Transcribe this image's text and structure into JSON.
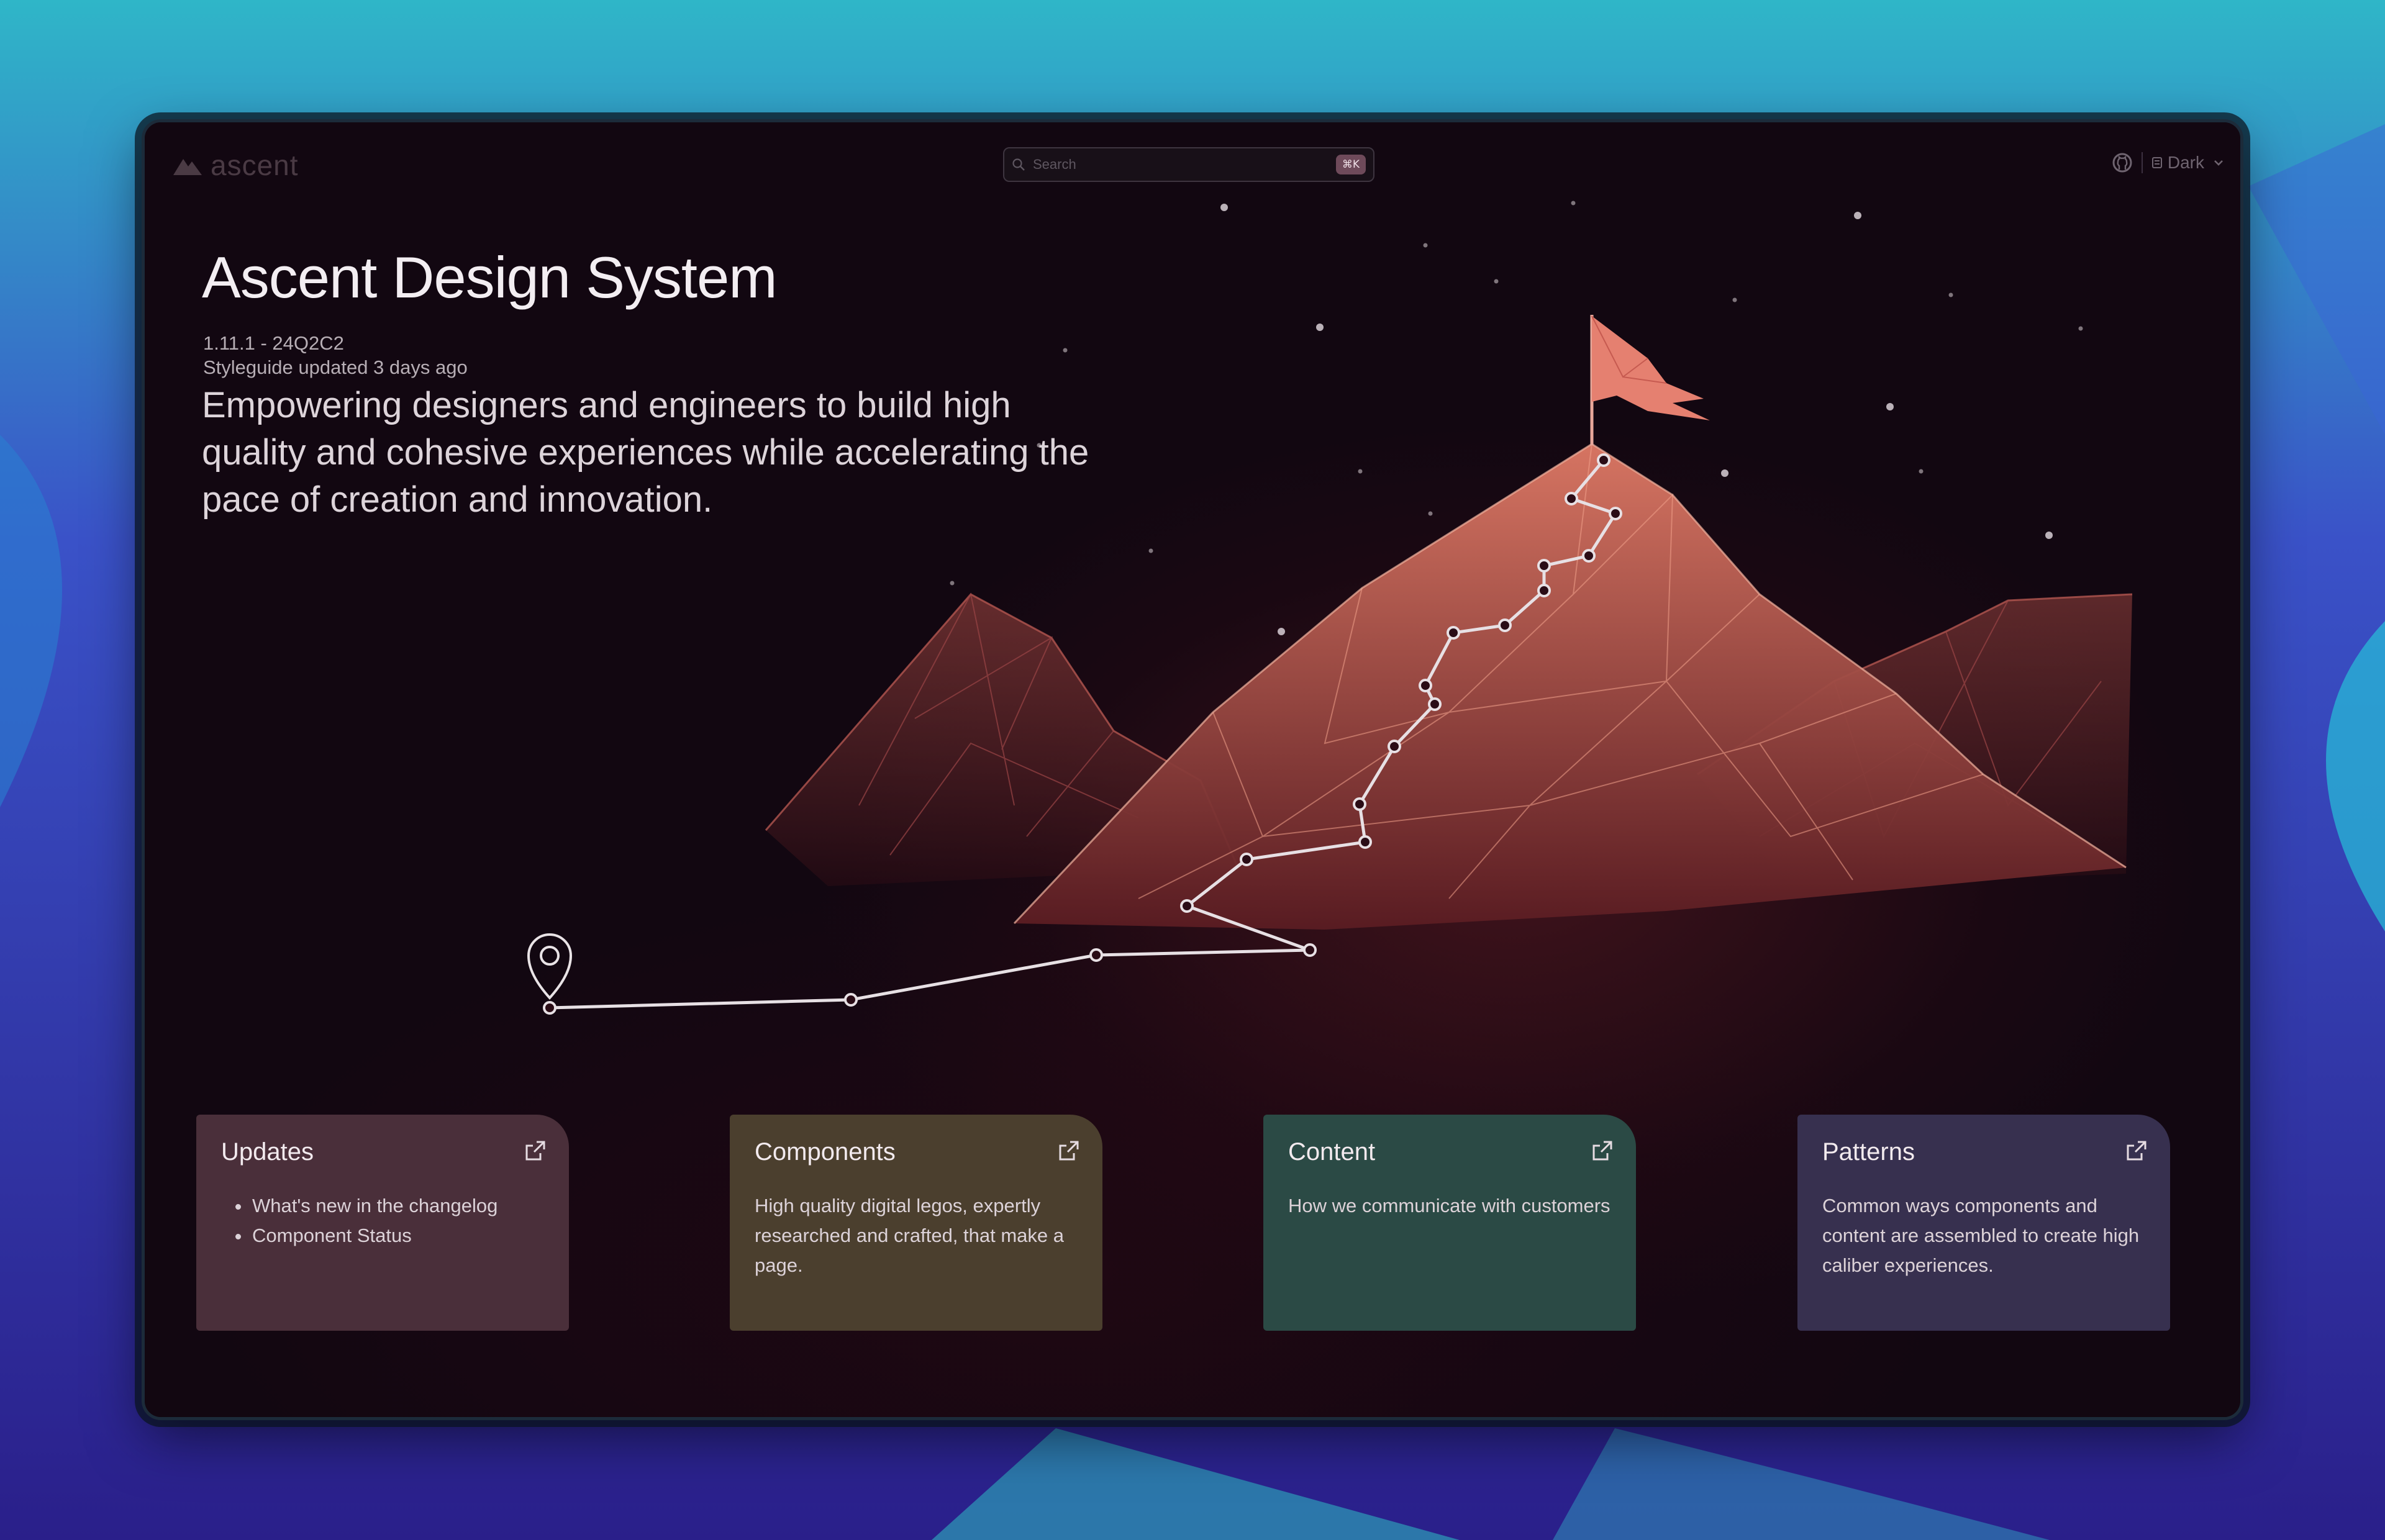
{
  "app": {
    "logo_text": "ascent",
    "search": {
      "placeholder": "Search",
      "shortcut": "⌘K"
    },
    "theme": {
      "selected": "Dark"
    }
  },
  "hero": {
    "title": "Ascent Design System",
    "version": "1.11.1 - 24Q2C2",
    "updated": "Styleguide updated 3 days ago",
    "tagline": "Empowering designers and engineers to build high quality and cohesive experiences while accelerating the pace of creation and innovation."
  },
  "cards": [
    {
      "title": "Updates",
      "items": [
        "What's new in the changelog",
        "Component Status"
      ],
      "color": "#4a2f3a"
    },
    {
      "title": "Components",
      "body": "High quality digital legos, expertly researched and crafted, that make a page.",
      "color": "#4b3f2e"
    },
    {
      "title": "Content",
      "body": "How we communicate with customers",
      "color": "#2b4a45"
    },
    {
      "title": "Patterns",
      "body": "Common ways components and content are assembled to create high caliber experiences.",
      "color": "#37304f"
    }
  ],
  "icons": {
    "logo": "mountain-logo-icon",
    "search": "search-icon",
    "github": "github-icon",
    "theme": "theme-icon",
    "chevron": "chevron-down-icon",
    "card_link": "external-link-icon",
    "location": "map-pin-icon",
    "flag": "flag-icon"
  }
}
